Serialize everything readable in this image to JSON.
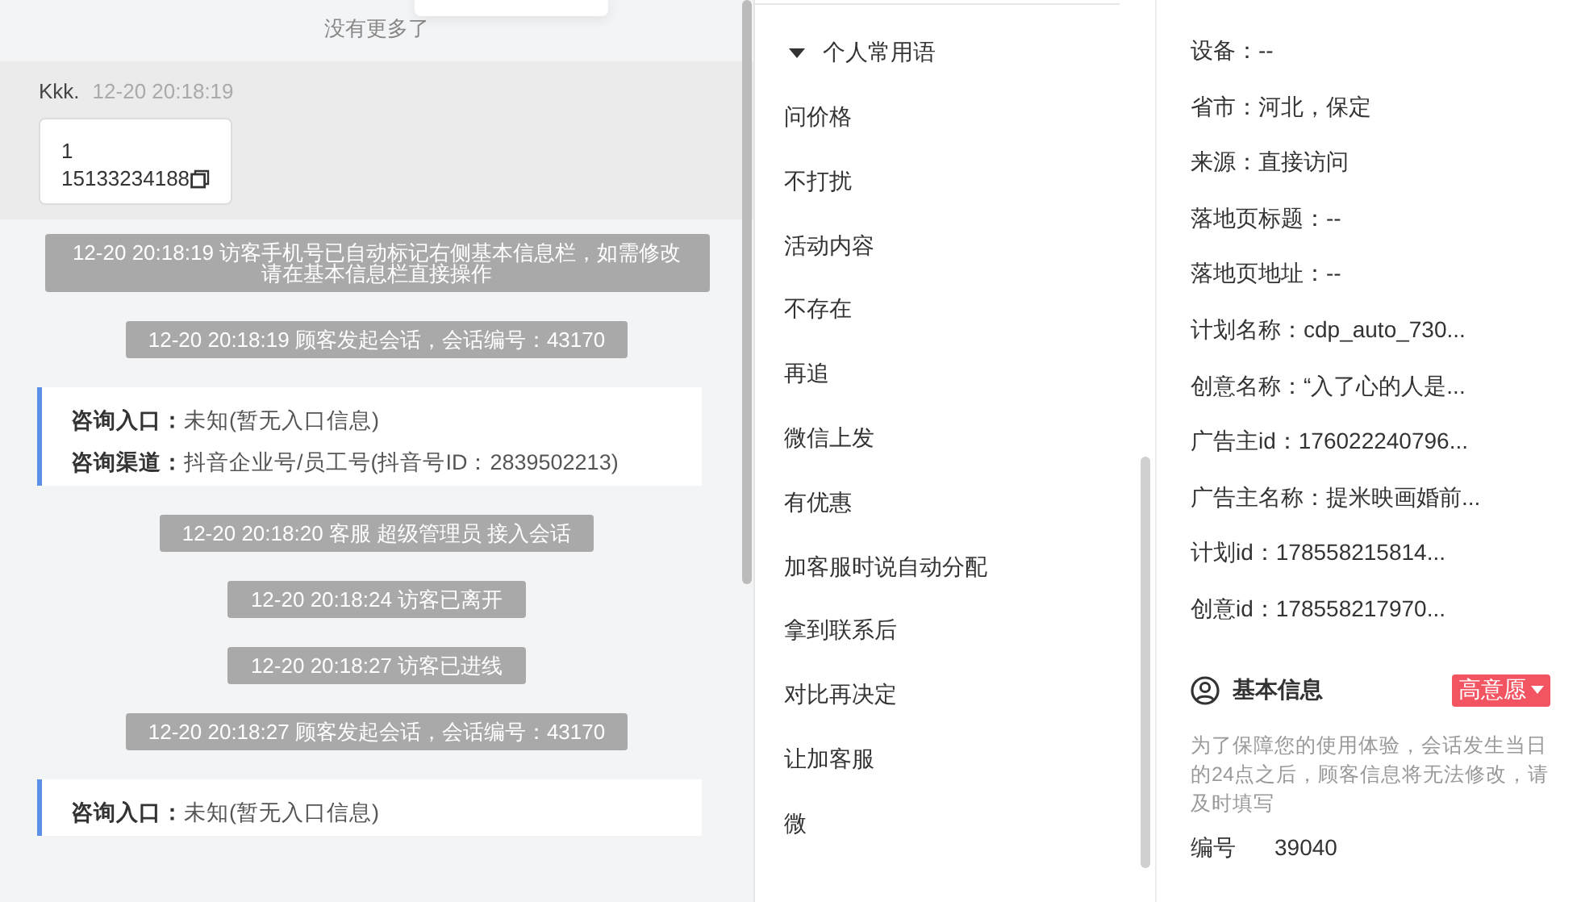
{
  "chat": {
    "no_more": "没有更多了",
    "messages": [
      {
        "kind": "visitor",
        "sender": "Kkk.",
        "time": "12-20 20:18:19",
        "lines": [
          "1",
          "15133234188"
        ]
      },
      {
        "kind": "system",
        "text": "12-20 20:18:19 访客手机号已自动标记右侧基本信息栏，如需修改请在基本信息栏直接操作"
      },
      {
        "kind": "system",
        "text": "12-20 20:18:19 顾客发起会话，会话编号：43170"
      },
      {
        "kind": "entry",
        "fields": [
          {
            "label": "咨询入口：",
            "value": "未知(暂无入口信息)"
          },
          {
            "label": "咨询渠道：",
            "value": "抖音企业号/员工号(抖音号ID：2839502213)"
          }
        ]
      },
      {
        "kind": "system",
        "text": "12-20 20:18:20 客服 超级管理员 接入会话"
      },
      {
        "kind": "system",
        "text": "12-20 20:18:24 访客已离开"
      },
      {
        "kind": "system",
        "text": "12-20 20:18:27 访客已进线"
      },
      {
        "kind": "system",
        "text": "12-20 20:18:27 顾客发起会话，会话编号：43170"
      },
      {
        "kind": "entry",
        "fields": [
          {
            "label": "咨询入口：",
            "value": "未知(暂无入口信息)"
          }
        ]
      }
    ]
  },
  "phrases": {
    "group": {
      "title": "个人常用语",
      "expanded": true
    },
    "items": [
      "问价格",
      "不打扰",
      "活动内容",
      "不存在",
      "再追",
      "微信上发",
      "有优惠",
      "加客服时说自动分配",
      "拿到联系后",
      "对比再决定",
      "让加客服",
      "微"
    ]
  },
  "info": {
    "lines": [
      "设备：--",
      "省市：河北，保定",
      "来源：直接访问",
      "落地页标题：--",
      "落地页地址：--",
      "计划名称：cdp_auto_730...",
      "创意名称：“入了心的人是...",
      "广告主id：176022240796...",
      "广告主名称：提米映画婚前...",
      "计划id：178558215814...",
      "创意id：178558217970..."
    ],
    "basic": {
      "title": "基本信息",
      "tag": "高意愿",
      "note": "为了保障您的使用体验，会话发生当日的24点之后，顾客信息将无法修改，请及时填写",
      "fields": [
        {
          "label": "编号",
          "value": "39040"
        }
      ]
    }
  }
}
